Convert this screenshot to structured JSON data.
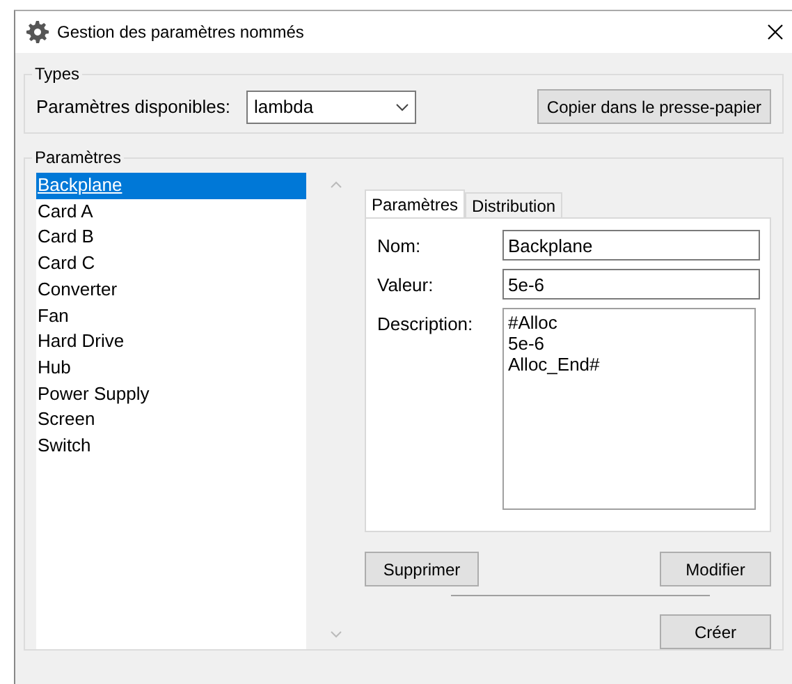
{
  "window": {
    "title": "Gestion des paramètres nommés"
  },
  "types": {
    "legend": "Types",
    "label": "Paramètres disponibles:",
    "dropdown": {
      "value": "lambda"
    },
    "copy_button": "Copier dans le presse-papier"
  },
  "parameters": {
    "legend": "Paramètres",
    "items": [
      {
        "label": "Backplane",
        "selected": true
      },
      {
        "label": "Card A",
        "selected": false
      },
      {
        "label": "Card B",
        "selected": false
      },
      {
        "label": "Card C",
        "selected": false
      },
      {
        "label": "Converter",
        "selected": false
      },
      {
        "label": "Fan",
        "selected": false
      },
      {
        "label": "Hard Drive",
        "selected": false
      },
      {
        "label": "Hub",
        "selected": false
      },
      {
        "label": "Power Supply",
        "selected": false
      },
      {
        "label": "Screen",
        "selected": false
      },
      {
        "label": "Switch",
        "selected": false
      }
    ]
  },
  "tabs": [
    {
      "label": "Paramètres",
      "selected": true
    },
    {
      "label": "Distribution",
      "selected": false
    }
  ],
  "form": {
    "name_label": "Nom:",
    "name_value": "Backplane",
    "value_label": "Valeur:",
    "value_value": "5e-6",
    "description_label": "Description:",
    "description_lines": [
      "#Alloc",
      "5e-6",
      "Alloc_End#"
    ]
  },
  "buttons": {
    "delete": "Supprimer",
    "modify": "Modifier",
    "create": "Créer"
  }
}
